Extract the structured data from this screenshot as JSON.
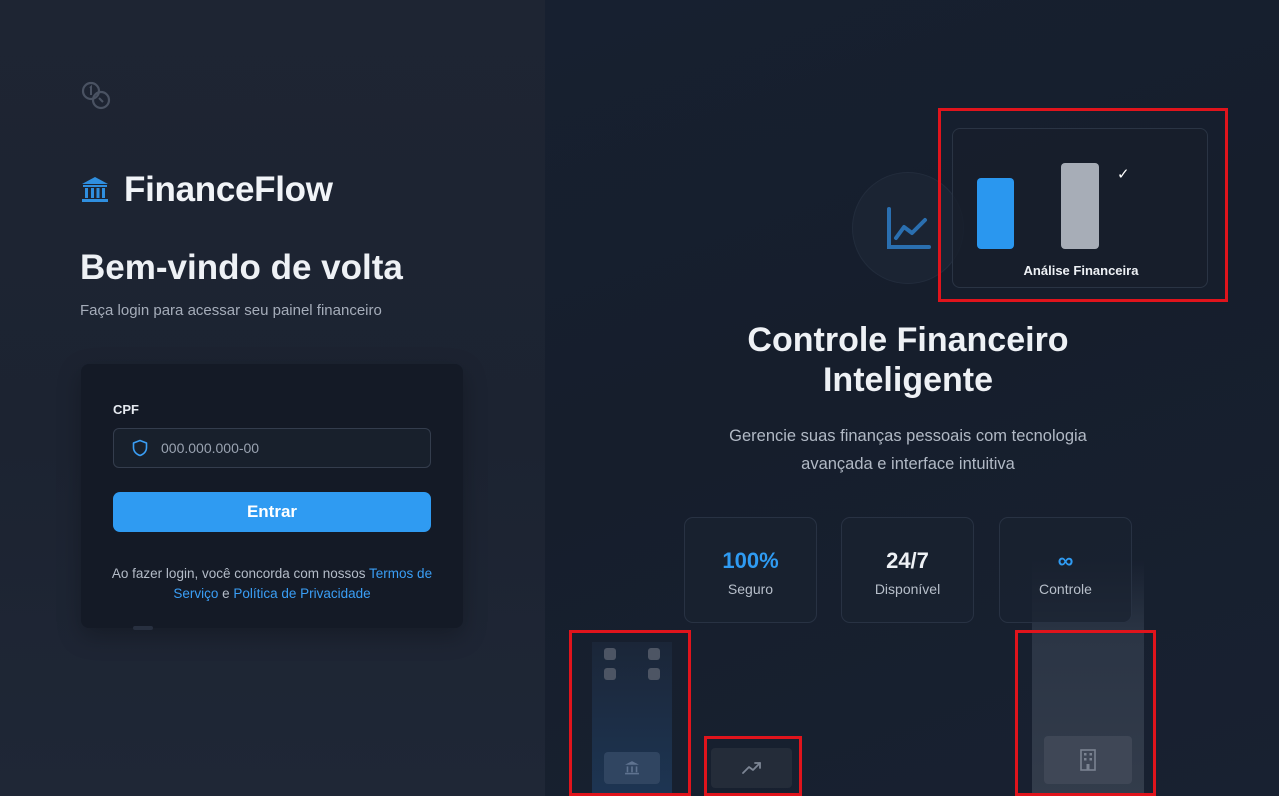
{
  "brand": {
    "name": "FinanceFlow",
    "logo_icon": "bank-icon",
    "corner_icon": "coins-icon"
  },
  "login": {
    "title": "Bem-vindo de volta",
    "subtitle": "Faça login para acessar seu painel financeiro",
    "cpf_label": "CPF",
    "cpf_placeholder": "000.000.000-00",
    "cpf_value": "",
    "field_icon": "shield-icon",
    "submit_label": "Entrar",
    "terms_prefix": "Ao fazer login, você concorda com nossos ",
    "terms_link": "Termos de Serviço",
    "terms_joiner": " e ",
    "privacy_link": "Política de Privacidade"
  },
  "hero": {
    "analysis_card_label": "Análise Financeira",
    "check_mark": "✓",
    "headline": "Controle Financeiro Inteligente",
    "subline": "Gerencie suas finanças pessoais com tecnologia avançada e interface intuitiva",
    "stats": [
      {
        "value": "100%",
        "label": "Seguro",
        "color": "#2f9bf2"
      },
      {
        "value": "24/7",
        "label": "Disponível",
        "color": "#eef1f5"
      },
      {
        "value": "∞",
        "label": "Controle",
        "color": "#2f9bf2"
      }
    ]
  },
  "colors": {
    "accent": "#2f9bf2",
    "highlight_box": "#e0141c"
  }
}
